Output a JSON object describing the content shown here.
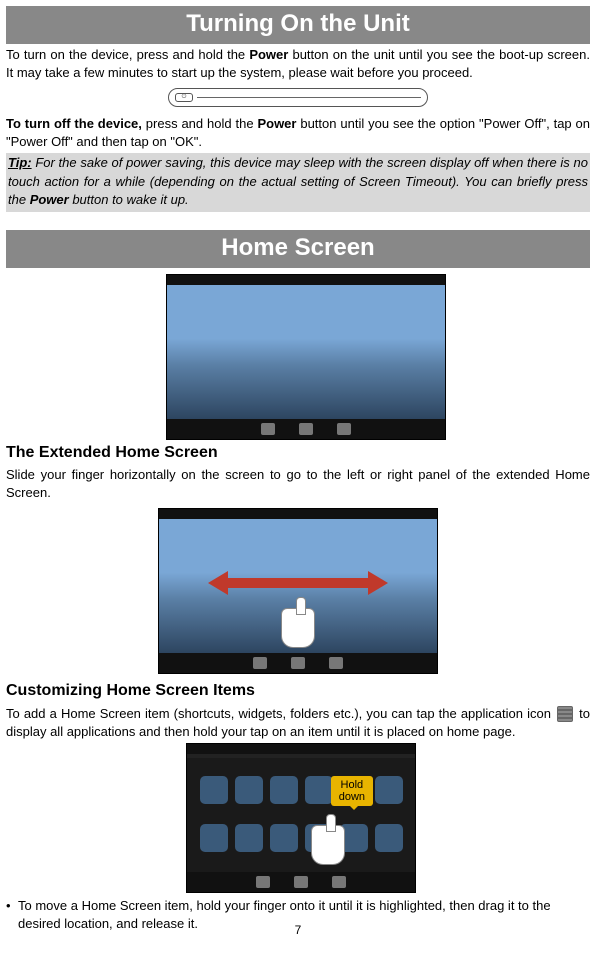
{
  "sections": {
    "turning_on": {
      "title": "Turning On the Unit",
      "p1_a": "To turn on the device, press and hold the ",
      "p1_bold1": "Power",
      "p1_b": " button on the unit until you see the boot-up screen. It may take a few minutes to start up the system, please wait before you proceed.",
      "p2_bold": "To turn off the device,",
      "p2_a": " press and hold the ",
      "p2_bold2": "Power",
      "p2_b": " button until you see the option \"Power Off\", tap on \"Power Off\" and then tap on \"OK\".",
      "tip_label": "Tip:",
      "tip_a": " For the sake of power saving, this device may sleep with the screen display off when there is no touch action for a while (depending on the actual setting of Screen Timeout). You can briefly press the ",
      "tip_bold": "Power",
      "tip_b": " button to wake it up."
    },
    "home_screen": {
      "title": "Home Screen",
      "sub1": "The Extended Home Screen",
      "p1": "Slide your finger horizontally on the screen to go to the left or right panel of the extended Home Screen.",
      "sub2": "Customizing Home Screen Items",
      "p2_a": "To add a Home Screen item (shortcuts, widgets, folders etc.), you can tap the application icon ",
      "p2_b": " to display all applications and then hold your tap on an item until it is placed on home page.",
      "callout_l1": "Hold",
      "callout_l2": "down",
      "bullet1": "To move a Home Screen item, hold your finger onto it until it is highlighted, then drag it to the desired location, and release it."
    }
  },
  "page_number": "7"
}
